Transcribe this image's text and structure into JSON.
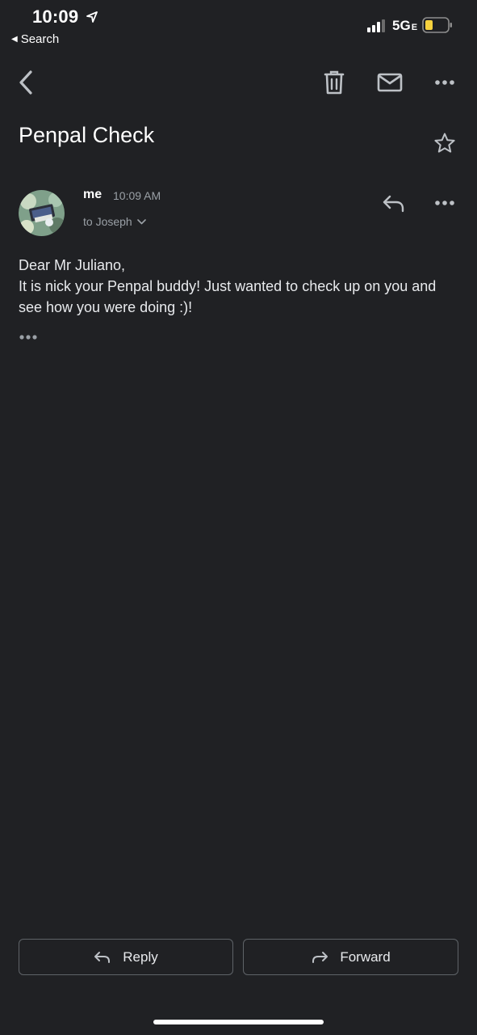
{
  "status_bar": {
    "time": "10:09",
    "back_app_label": "Search",
    "network": "5G",
    "network_suffix": "E",
    "battery_color": "#f7d23e"
  },
  "toolbar": {
    "icons": [
      "back-chevron-icon",
      "trash-icon",
      "mail-icon",
      "more-horizontal-icon"
    ]
  },
  "email": {
    "subject": "Penpal Check",
    "sender": "me",
    "time": "10:09 AM",
    "recipient": "to Joseph",
    "body_lines": [
      "Dear Mr Juliano,",
      "It is nick your Penpal buddy! Just wanted to check up on you and see how you were doing :)!"
    ]
  },
  "actions": {
    "reply_label": "Reply",
    "forward_label": "Forward"
  },
  "colors": {
    "background": "#202124",
    "text": "#e8eaed",
    "secondary_text": "#9aa0a6",
    "icon": "#bdc1c6",
    "button_border": "#5f6368"
  }
}
